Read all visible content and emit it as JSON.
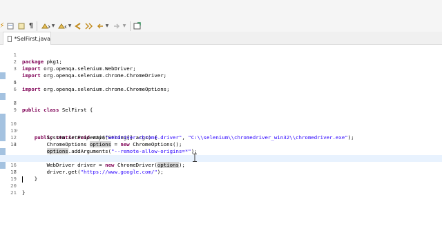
{
  "toolbar": {
    "icons": [
      "sync-icon",
      "toggle-breadcrumb-icon",
      "mark-occurrences-icon",
      "block-selection-icon",
      "show-whitespace-icon",
      "next-annotation-icon",
      "previous-annotation-icon",
      "last-edit-icon",
      "back-icon",
      "forward-icon",
      "pin-editor-icon"
    ]
  },
  "tab": {
    "title": "*SelFirst.java",
    "close_glyph": "✕"
  },
  "editor": {
    "lines": [
      {
        "n": "1",
        "t": "package pkg1;"
      },
      {
        "n": "2",
        "t": "import org.openqa.selenium.WebDriver;"
      },
      {
        "n": "3",
        "t": "import org.openqa.selenium.chrome.ChromeDriver;"
      },
      {
        "n": "4",
        "t": "import org.openqa.selenium.chrome.ChromeOptions;"
      },
      {
        "n": "5",
        "t": ""
      },
      {
        "n": "6",
        "t": ""
      },
      {
        "n": "7",
        "t": ""
      },
      {
        "n": "8",
        "t": "public class SelFirst {"
      },
      {
        "n": "9",
        "t": ""
      },
      {
        "n": "10",
        "t": "    public static void main(String[] args) {"
      },
      {
        "n": "11",
        "t": "        System.setProperty(\"webdriver.chrome.driver\", \"C:\\\\selenium\\\\chromedriver_win32\\\\chromedriver.exe\");"
      },
      {
        "n": "12",
        "t": "        ChromeOptions options = new ChromeOptions();"
      },
      {
        "n": "13",
        "t": "        options.addArguments(\"--remote-allow-origins=*\");"
      },
      {
        "n": "14",
        "t": ""
      },
      {
        "n": "15",
        "t": "        WebDriver driver = new ChromeDriver(options);"
      },
      {
        "n": "16",
        "t": "        driver.get(\"https://www.google.com/\");"
      },
      {
        "n": "17",
        "t": ""
      },
      {
        "n": "18",
        "t": "    }"
      },
      {
        "n": "19",
        "t": ""
      },
      {
        "n": "20",
        "t": "}"
      },
      {
        "n": "21",
        "t": ""
      }
    ],
    "current_line": "17",
    "modified_lines": [
      "4",
      "7",
      "10",
      "11",
      "12",
      "13",
      "15",
      "16",
      "17"
    ],
    "fold_lines": [
      "10"
    ]
  }
}
